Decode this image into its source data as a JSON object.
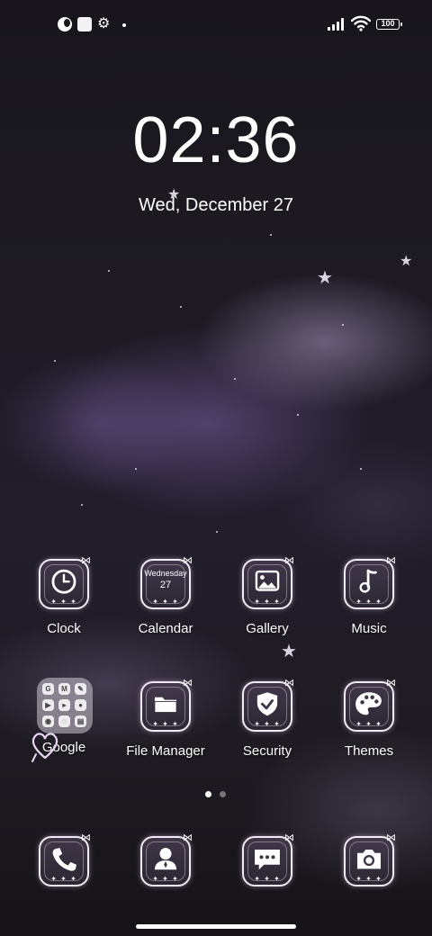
{
  "status_bar": {
    "left_icons": [
      "moon-icon",
      "square-icon",
      "gear-icon",
      "dot-icon"
    ],
    "battery_level": "100",
    "right_icons": [
      "signal-icon",
      "wifi-icon",
      "battery-icon"
    ]
  },
  "lockclock": {
    "time": "02:36",
    "date": "Wed, December 27"
  },
  "apps_row1": [
    {
      "label": "Clock",
      "icon": "clock-icon"
    },
    {
      "label": "Calendar",
      "icon": "calendar-icon",
      "day": "Wednesday",
      "date": "27"
    },
    {
      "label": "Gallery",
      "icon": "gallery-icon"
    },
    {
      "label": "Music",
      "icon": "music-icon"
    }
  ],
  "apps_row2": [
    {
      "label": "Google",
      "icon": "google-folder-icon"
    },
    {
      "label": "File Manager",
      "icon": "folder-icon"
    },
    {
      "label": "Security",
      "icon": "shield-check-icon"
    },
    {
      "label": "Themes",
      "icon": "palette-icon"
    }
  ],
  "google_folder": [
    "G",
    "M",
    "✎",
    "▶",
    "▸",
    "●",
    "◉",
    "◌",
    "▤"
  ],
  "dock": [
    {
      "icon": "phone-icon"
    },
    {
      "icon": "contacts-icon"
    },
    {
      "icon": "messages-icon"
    },
    {
      "icon": "camera-icon"
    }
  ],
  "page_indicator": {
    "pages": 2,
    "current": 1
  },
  "colors": {
    "accent": "#f1eaf5",
    "background": "#1d1a23"
  }
}
